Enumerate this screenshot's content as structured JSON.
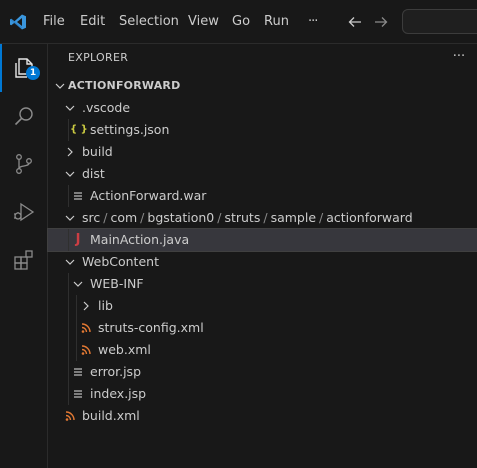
{
  "menu": {
    "items": [
      "File",
      "Edit",
      "Selection",
      "View",
      "Go",
      "Run"
    ],
    "more_glyph": "···"
  },
  "activity": {
    "explorer_badge": "1",
    "icons": [
      "files-icon",
      "search-icon",
      "source-control-icon",
      "run-debug-icon",
      "extensions-icon"
    ]
  },
  "sidebar": {
    "title": "EXPLORER",
    "more_glyph": "···",
    "section_label": "ACTIONFORWARD"
  },
  "tree": {
    "vscode": ".vscode",
    "settings": "settings.json",
    "build": "build",
    "dist": "dist",
    "war": "ActionForward.war",
    "src_path": [
      "src",
      "com",
      "bgstation0",
      "struts",
      "sample",
      "actionforward"
    ],
    "main_action": "MainAction.java",
    "webcontent": "WebContent",
    "webinf": "WEB-INF",
    "lib": "lib",
    "struts_config": "struts-config.xml",
    "web_xml": "web.xml",
    "error_jsp": "error.jsp",
    "index_jsp": "index.jsp",
    "build_xml": "build.xml"
  },
  "colors": {
    "accent": "#0078d4",
    "json_icon": "#cbcb41",
    "java_icon": "#cc3e44",
    "xml_icon": "#e37933"
  }
}
